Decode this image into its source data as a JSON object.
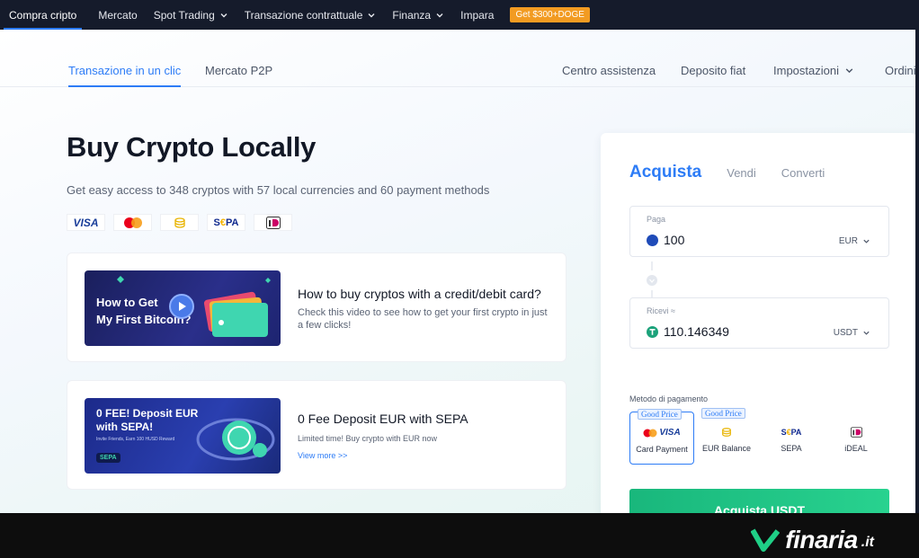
{
  "topnav": {
    "items": [
      {
        "label": "Compra cripto",
        "dropdown": false,
        "active": true
      },
      {
        "label": "Mercato",
        "dropdown": false
      },
      {
        "label": "Spot Trading",
        "dropdown": true
      },
      {
        "label": "Transazione contrattuale",
        "dropdown": true
      },
      {
        "label": "Finanza",
        "dropdown": true
      },
      {
        "label": "Impara",
        "dropdown": false
      }
    ],
    "promo": "Get $300+DOGE"
  },
  "subnav": {
    "left": [
      "Transazione in un clic",
      "Mercato P2P"
    ],
    "right": [
      "Centro assistenza",
      "Deposito fiat",
      "Impostazioni",
      "Ordini"
    ]
  },
  "hero": {
    "title": "Buy Crypto Locally",
    "subtitle": "Get easy access to 348 cryptos with 57 local currencies and 60 payment methods",
    "payment_logos": [
      "visa-icon",
      "mastercard-icon",
      "coin-stack-icon",
      "sepa-icon",
      "ideal-icon"
    ]
  },
  "cards": [
    {
      "thumb_text": [
        "How to Get",
        "My First Bitcoin?"
      ],
      "title": "How to buy cryptos with a credit/debit card?",
      "desc": "Check this video to see how to get your first crypto in just a few clicks!"
    },
    {
      "thumb_text": [
        "0 FEE! Deposit EUR",
        "with SEPA!"
      ],
      "thumb_small": "Invite Friends, Earn 100 HUSD Reward",
      "title": "0 Fee Deposit EUR with SEPA",
      "desc": "Limited time! Buy crypto with EUR now",
      "link": "View more >>"
    }
  ],
  "panel": {
    "tabs": [
      "Acquista",
      "Vendi",
      "Converti"
    ],
    "pay": {
      "label": "Paga",
      "value": "100",
      "currency": "EUR"
    },
    "receive": {
      "label": "Ricevi ≈",
      "value": "110.146349",
      "currency": "USDT"
    },
    "payment_label": "Metodo di pagamento",
    "methods": [
      {
        "name": "Card Payment",
        "badge": "Good Price",
        "selected": true
      },
      {
        "name": "EUR Balance",
        "badge": "Good Price",
        "selected": false
      },
      {
        "name": "SEPA",
        "badge": "",
        "selected": false
      },
      {
        "name": "iDEAL",
        "badge": "",
        "selected": false
      }
    ],
    "button": "Acquista USDT"
  },
  "branding": {
    "wordmark": "finaria",
    "tld": ".it"
  },
  "colors": {
    "accent": "#2d7cf6",
    "buy": "#22c486",
    "nav_bg": "#151b2b",
    "promo": "#f29b22"
  }
}
